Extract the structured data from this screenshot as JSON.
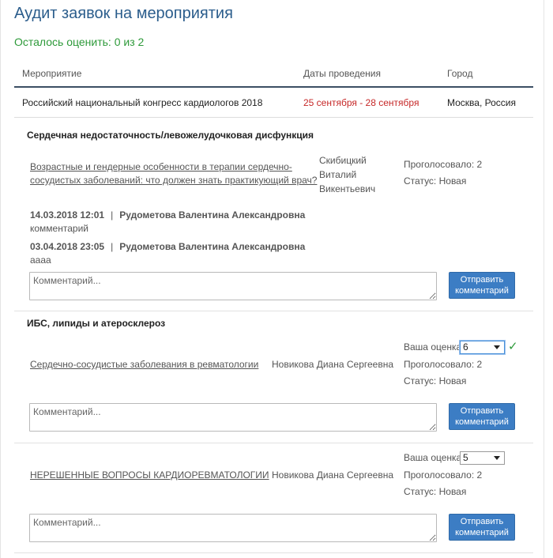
{
  "page": {
    "title": "Аудит заявок на мероприятия",
    "remaining": "Осталось оценить: 0 из 2"
  },
  "table": {
    "headers": [
      "Мероприятие",
      "Даты проведения",
      "Город"
    ],
    "event": {
      "name": "Российский национальный конгресс кардиологов 2018",
      "dates": "25 сентября - 28 сентября",
      "city": "Москва, Россия"
    }
  },
  "labels": {
    "your_score": "Ваша оценка",
    "comment_placeholder": "Комментарий...",
    "send_line1": "Отправить",
    "send_line2": "комментарий",
    "comment_separator": "|"
  },
  "colors": {
    "title": "#2b5d8c",
    "remaining": "#2e9a3a",
    "dates": "#c62828",
    "button": "#3c7dc4",
    "check": "#2e9a3a"
  },
  "sections": [
    {
      "title": "Сердечная недостаточность/левожелудочковая дисфункция",
      "items": [
        {
          "link_line1": "Возрастные и гендерные особенности в терапии сердечно-",
          "link_line2": "сосудистых заболеваний: что должен знать практикующий врач?",
          "author_line1": "Скибицкий",
          "author_line2": "Виталий",
          "author_line3": "Викентьевич",
          "votes": "Проголосовало: 2",
          "status": "Статус:  Новая",
          "comments": [
            {
              "datetime": "14.03.2018 12:01",
              "author": "Рудометова Валентина Александровна",
              "text": "комментарий"
            },
            {
              "datetime": "03.04.2018 23:05",
              "author": "Рудометова Валентина Александровна",
              "text": "аааа"
            }
          ]
        }
      ]
    },
    {
      "title": "ИБС, липиды и атеросклероз",
      "items": [
        {
          "link": "Сердечно-сосудистые заболевания в ревматологии",
          "author": "Новикова Диана Сергеевна",
          "score": "6",
          "saved_icon": "check-icon",
          "votes": "Проголосовало: 2",
          "status": "Статус:  Новая"
        },
        {
          "link": "НЕРЕШЕННЫЕ ВОПРОСЫ КАРДИОРЕВМАТОЛОГИИ",
          "author": "Новикова Диана Сергеевна",
          "score": "5",
          "votes": "Проголосовало: 2",
          "status": "Статус:  Новая"
        }
      ]
    }
  ]
}
